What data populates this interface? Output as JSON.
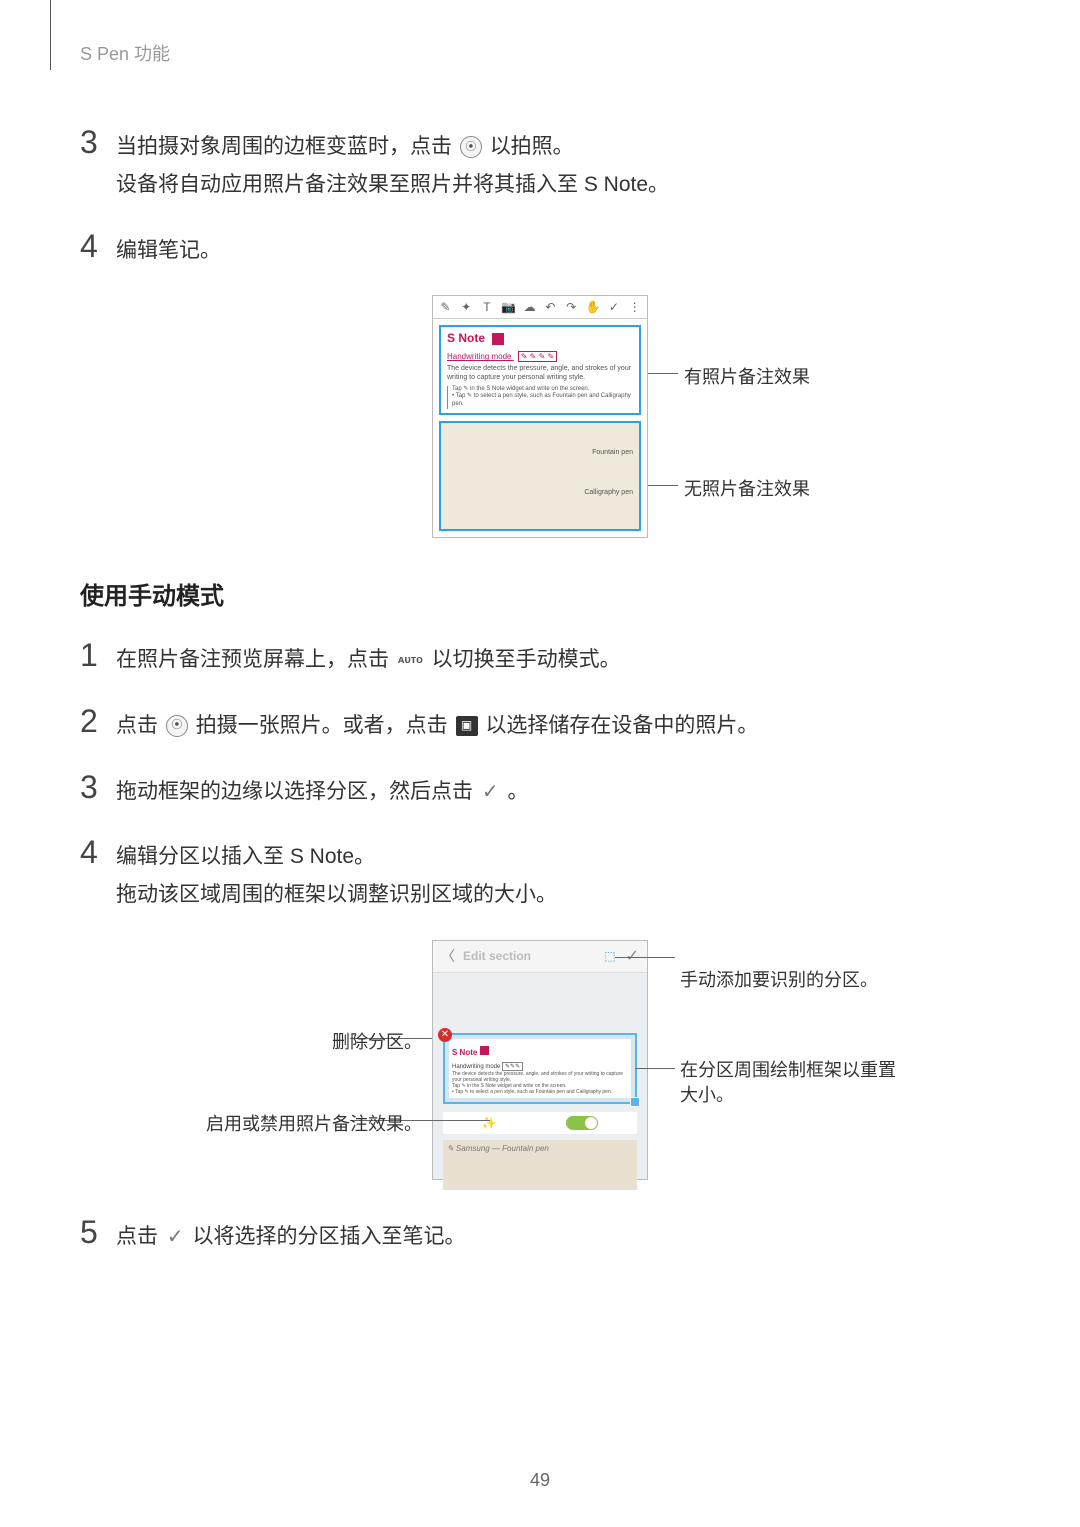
{
  "header": {
    "title": "S Pen 功能"
  },
  "page_number": "49",
  "steps_a": [
    {
      "num": "3",
      "lines": [
        {
          "pre": "当拍摄对象周围的边框变蓝时，点击 ",
          "icon": "camera",
          "post": " 以拍照。"
        },
        {
          "pre": "设备将自动应用照片备注效果至照片并将其插入至 S Note。"
        }
      ]
    },
    {
      "num": "4",
      "lines": [
        {
          "pre": "编辑笔记。"
        }
      ]
    }
  ],
  "fig1": {
    "toolbar": [
      "✎",
      "✦",
      "T",
      "📷",
      "☁",
      "↶",
      "↷",
      "✋",
      "✓",
      "⋮"
    ],
    "snote_label": "S Note",
    "hw_label": "Handwriting mode",
    "hw_icons": "✎ ✎ ✎ ✎",
    "desc": "The device detects the pressure, angle, and strokes of your writing to capture your personal writing style.",
    "sub1": "Tap ✎ in the S Note widget and write on the screen.",
    "sub2": "• Tap ✎ to select a pen style, such as Fountain pen and Calligraphy pen.",
    "pen_labels": {
      "fountain": "Fountain pen",
      "calligraphy": "Calligraphy pen"
    },
    "annot_top": "有照片备注效果",
    "annot_bottom": "无照片备注效果"
  },
  "section_title": "使用手动模式",
  "steps_b": [
    {
      "num": "1",
      "lines": [
        {
          "pre": "在照片备注预览屏幕上，点击 ",
          "icon": "auto",
          "post": " 以切换至手动模式。"
        }
      ]
    },
    {
      "num": "2",
      "lines": [
        {
          "pre": "点击 ",
          "icon": "camera",
          "mid": " 拍摄一张照片。或者，点击 ",
          "icon2": "gallery",
          "post": " 以选择储存在设备中的照片。"
        }
      ]
    },
    {
      "num": "3",
      "lines": [
        {
          "pre": "拖动框架的边缘以选择分区，然后点击 ",
          "icon": "check",
          "post": "。"
        }
      ]
    },
    {
      "num": "4",
      "lines": [
        {
          "pre": "编辑分区以插入至 S Note。"
        },
        {
          "pre": "拖动该区域周围的框架以调整识别区域的大小。"
        }
      ]
    }
  ],
  "fig2": {
    "back": "〈",
    "title": "Edit section",
    "handle": "⬚",
    "check": "✓",
    "snote_label": "S Note",
    "hw_label": "Handwriting mode",
    "desc1": "The device detects the pressure, angle, and strokes of your writing to capture your personal writing style.",
    "desc2": "Tap ✎ in the S Note widget and write on the screen.",
    "desc3": "• Tap ✎ to select a pen style, such as Fountain pen and Calligraphy pen.",
    "photo_text": "✎ Samsung — Fountain pen",
    "annot_add": "手动添加要识别的分区。",
    "annot_delete": "删除分区。",
    "annot_frame_l1": "在分区周围绘制框架以重置",
    "annot_frame_l2": "大小。",
    "annot_toggle": "启用或禁用照片备注效果。"
  },
  "steps_c": [
    {
      "num": "5",
      "lines": [
        {
          "pre": "点击 ",
          "icon": "check",
          "post": " 以将选择的分区插入至笔记。"
        }
      ]
    }
  ]
}
